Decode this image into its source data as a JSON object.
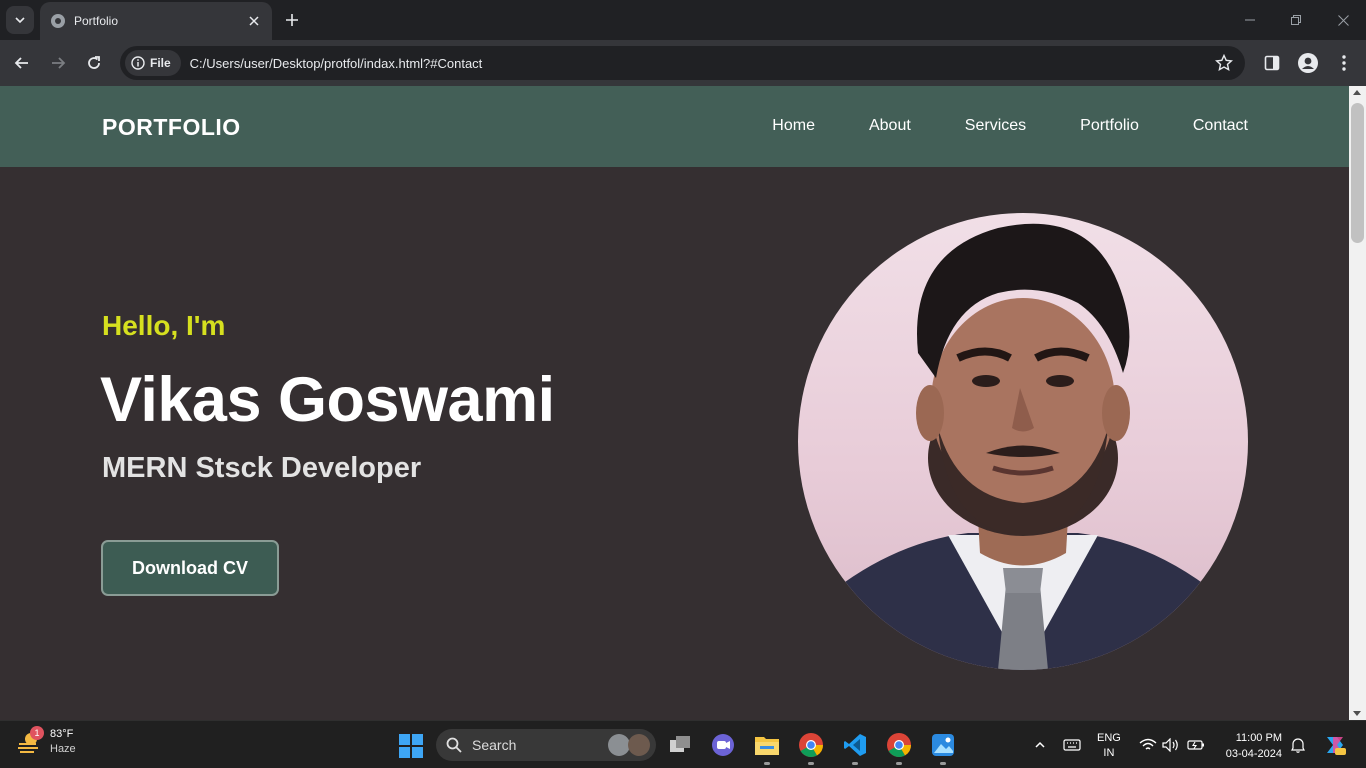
{
  "browser": {
    "tab_title": "Portfolio",
    "chip_label": "File",
    "url": "C:/Users/user/Desktop/protfol/indax.html?#Contact",
    "icons": [
      "tab-search-icon",
      "globe-icon",
      "close-icon",
      "plus-icon",
      "minimize-icon",
      "restore-icon",
      "back-icon",
      "forward-icon",
      "reload-icon",
      "info-icon",
      "star-icon",
      "sidebar-icon",
      "profile-icon",
      "menu-icon"
    ]
  },
  "site": {
    "logo": "PORTFOLIO",
    "nav": [
      {
        "label": "Home"
      },
      {
        "label": "About"
      },
      {
        "label": "Services"
      },
      {
        "label": "Portfolio"
      },
      {
        "label": "Contact"
      }
    ],
    "hero": {
      "greeting": "Hello, I'm",
      "name": "Vikas Goswami",
      "role": "MERN Stsck Developer",
      "cta": "Download CV",
      "photo_icon": "profile-photo"
    },
    "colors": {
      "header_bg": "#435f57",
      "page_bg": "#352f31",
      "greeting": "#d6e01f",
      "button_bg": "#3d5c53"
    }
  },
  "taskbar": {
    "weather": {
      "temp": "83°F",
      "condition": "Haze",
      "badge": "1"
    },
    "search_label": "Search",
    "lang": {
      "line1": "ENG",
      "line2": "IN"
    },
    "clock": {
      "time": "11:00 PM",
      "date": "03-04-2024"
    },
    "apps": [
      "task-view-icon",
      "meet-icon",
      "file-explorer-icon",
      "chrome-icon",
      "vscode-icon",
      "chrome-icon",
      "photos-icon"
    ]
  }
}
